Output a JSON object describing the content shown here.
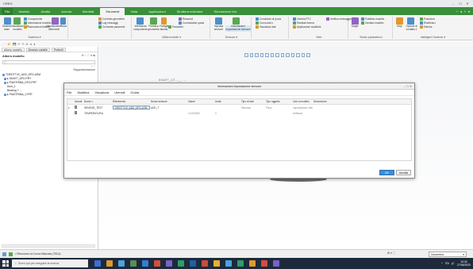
{
  "window": {
    "app_title": "CREO",
    "controls": [
      "–",
      "☐",
      "✕"
    ]
  },
  "ribbon_tabs": [
    "File",
    "Modello",
    "Analisi",
    "Annota",
    "Manifatt.",
    "Strumenti",
    "Vista",
    "Applicazioni",
    "Struttura reticolare",
    "Simulazione live"
  ],
  "ribbon_right_controls": [
    "^",
    "◂",
    "?",
    "▾"
  ],
  "ribbon": {
    "groups": [
      {
        "label": "Esamina ▾",
        "items": [
          "Componente",
          "Informazioni modello",
          "Informazioni feature"
        ],
        "big": [
          "Distinta base",
          "Visualizzazione modello",
          "Visualizzatore riferimenti",
          "Trova"
        ]
      },
      {
        "label": "",
        "items": [
          "Controllo geometria",
          "Log messaggi",
          "Confronta parametri"
        ],
        "big": []
      },
      {
        "label": "Utilità modello ▾",
        "items": [
          "Relazioni",
          "Commutatori quota",
          "Relazioni"
        ],
        "big": [
          "Interfaccia componente",
          "Pubblica geometria",
          "Famiglie tabella",
          "Parametri"
        ]
      },
      {
        "label": "Sensore ▾",
        "items": [],
        "big": [
          "Imposta sensore",
          "Informazioni impostazione sensore"
        ]
      },
      {
        "label": "",
        "items": [
          "Condizioni di prova",
          "Curva dati ▾",
          "Visualizza dati"
        ],
        "big": []
      },
      {
        "label": "Web",
        "items": [
          "Libreria PTC",
          "Risultati ricerca",
          "Applicazioni ausiliarie",
          "Verifica messaggeri"
        ],
        "big": []
      },
      {
        "label": "Studio parametrico",
        "items": [
          "Pubblica modello",
          "Gestisci modello"
        ],
        "big": [
          "Target"
        ]
      },
      {
        "label": "Intelligent Fastener ▾",
        "items": [
          "Posiziona",
          "Ridefinisci",
          "Elimina"
        ],
        "big": [
          "Mdp",
          "Opzioni di contatto ▾"
        ]
      }
    ]
  },
  "quick_toolbar": [
    "📄",
    "📂",
    "💾",
    "↶",
    "↷",
    "⟳",
    "✕",
    "▾"
  ],
  "left_panel": {
    "tabs": [
      "Albero modello",
      "Browser cartelle",
      "Preferiti"
    ],
    "header": "Albero modello",
    "tools": "🗎 ▾ 📄 ▾ ⇆",
    "filter_placeholder": "▽",
    "filter_tools": "⌄ ↑",
    "representation_label": "Rappresentazione",
    "tree": [
      {
        "label": "THROTTLE_ADD_DFD.ASM",
        "level": 0,
        "selected": false
      },
      {
        "label": "▸ SHAFT_DFD.PRT",
        "level": 1,
        "selected": false
      },
      {
        "label": "▸ PIASTRINA_DFD.PRT",
        "level": 1,
        "selected": false
      },
      {
        "label": "Asm_1",
        "level": 2,
        "selected": false
      },
      {
        "label": "Bearing + ...",
        "level": 2,
        "selected": false
      },
      {
        "label": "▸ PIASTRINA_1.PRT",
        "level": 1,
        "selected": false
      }
    ]
  },
  "view_toolbar_count": 13,
  "sketch_label": "SHAFT_OT...__ ...",
  "dialog": {
    "title": "Informazioni impostazione sensore",
    "title_controls": "– ☐ ✕",
    "menu": [
      "File",
      "Modifica",
      "Visualizza",
      "Utensili",
      "Guida"
    ],
    "columns": [
      "",
      "Includi",
      "Nome ▽",
      "Riferimento",
      "Nome sensore",
      "Valore",
      "Unità",
      "Tipo di dati",
      "Tipo oggetto",
      "Link a modello",
      "Descrizione"
    ],
    "rows": [
      {
        "expander": "▾",
        "include": true,
        "name": "SENSOR_TEST",
        "reference": "THROTTLE_ADD_DFD.ASM",
        "sensor_name": "ADD_T",
        "value": "",
        "unit": "",
        "data_type": "Misurato",
        "object_type": "Fisso",
        "model_link": "Impostazione della r",
        "description": ""
      },
      {
        "expander": "",
        "include": true,
        "name": "TEMPERATURA",
        "reference": "",
        "sensor_name": "",
        "value": "10.000000",
        "unit": "C",
        "data_type": "",
        "object_type": "",
        "model_link": "Definisci",
        "description": ""
      }
    ],
    "buttons": {
      "ok": "OK",
      "cancel": "Annulla"
    }
  },
  "status_bar": {
    "message": "• Rimuovere la Curva Misurata (TSD)1",
    "right_tools": "⊞ ▾   ⬚",
    "selection_filter": "Geometria"
  },
  "taskbar": {
    "search_placeholder": "Scrivi qui per eseguire la ricerca",
    "apps": [
      "#3a6fd8",
      "#e0982f",
      "#4aa3df",
      "#5a8d4f",
      "#2f7fd6",
      "#d24f3c",
      "#7a62c8",
      "#2d9d6c",
      "#1f5fa8",
      "#c94c3c",
      "#e8b22c",
      "#4aa3df",
      "#2d9d6c",
      "#e0982f",
      "#d24f3c",
      "#7a62c8"
    ],
    "tray": [
      "^",
      "ITA",
      "🔊"
    ],
    "time": "10:32",
    "date": "27/06/2023"
  }
}
